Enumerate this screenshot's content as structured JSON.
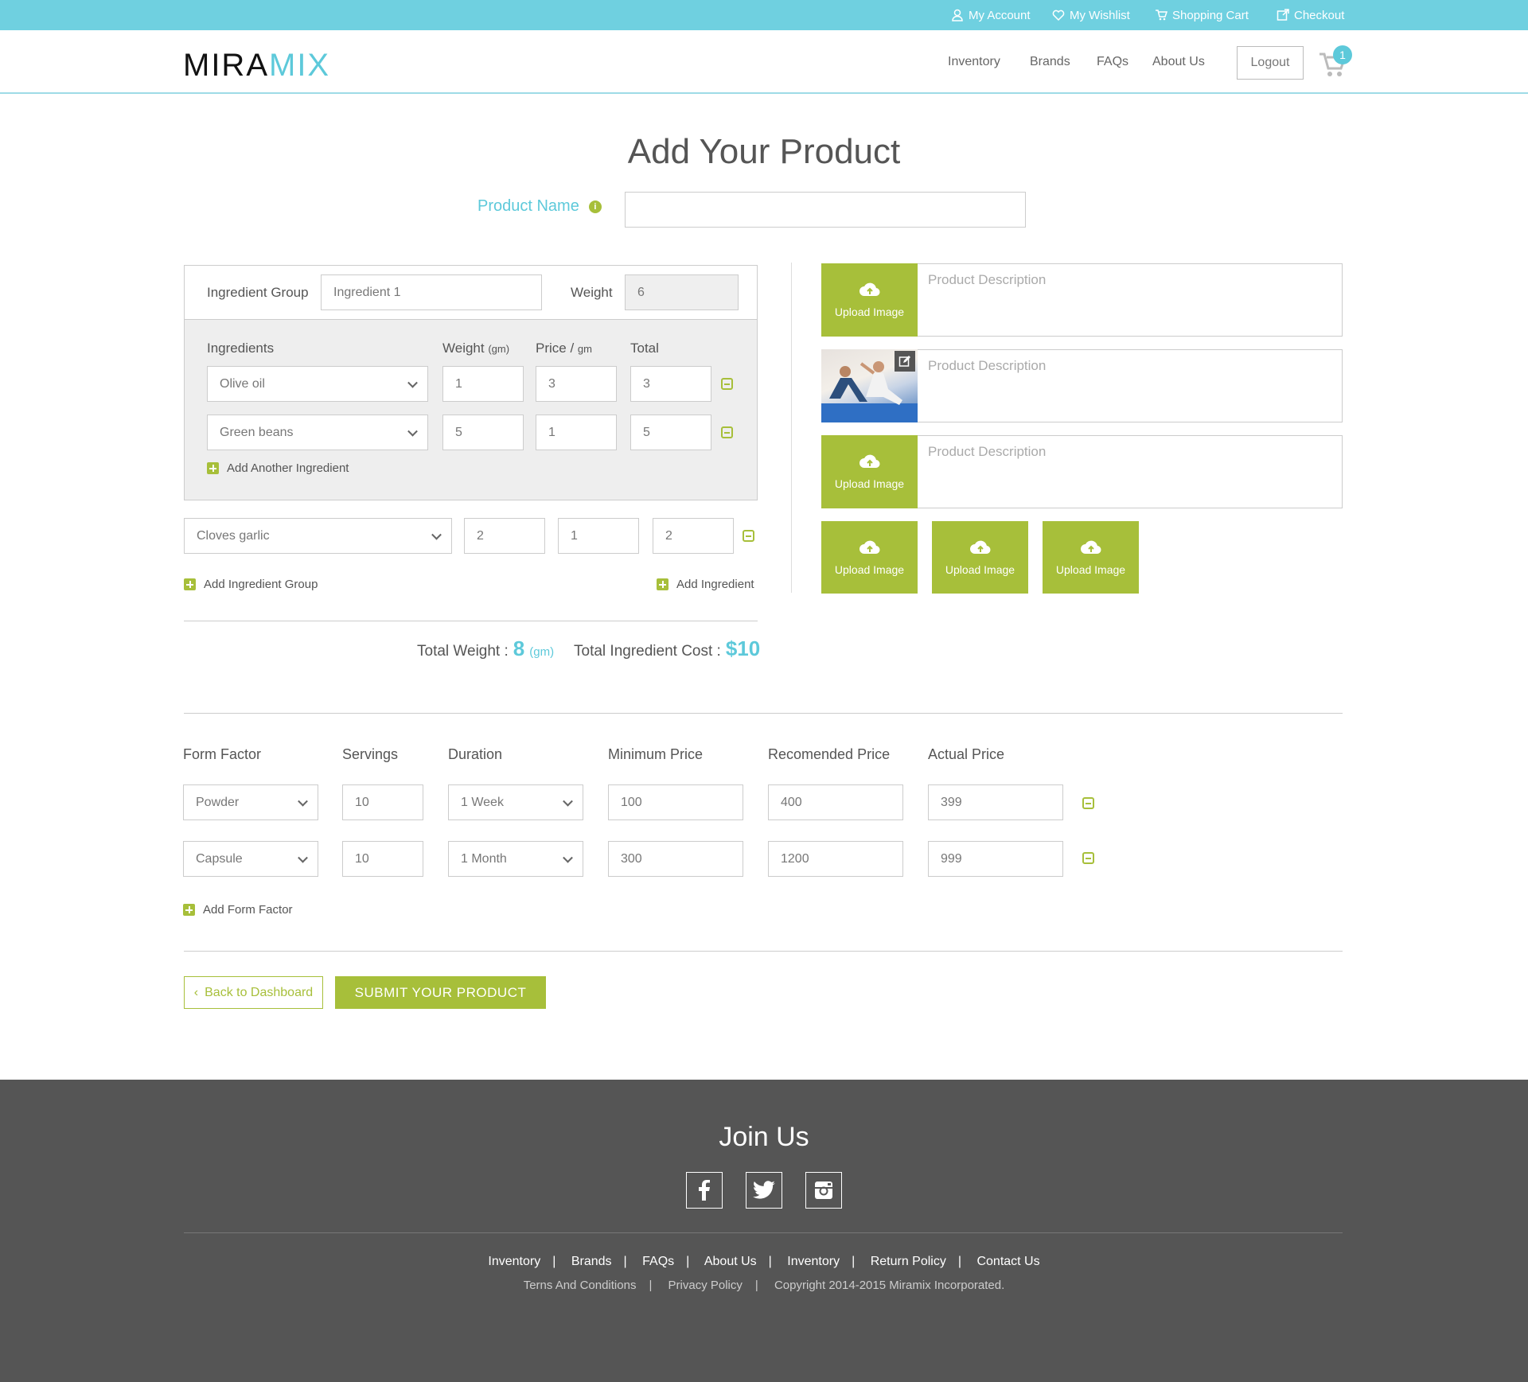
{
  "topbar": {
    "my_account": "My Account",
    "my_wishlist": "My Wishlist",
    "shopping_cart": "Shopping Cart",
    "checkout": "Checkout"
  },
  "header": {
    "logo_part1": "MIRA",
    "logo_part2": "MIX",
    "nav": [
      "Inventory",
      "Brands",
      "FAQs",
      "About Us"
    ],
    "logout": "Logout",
    "cart_count": "1"
  },
  "page": {
    "title": "Add Your Product",
    "product_name_label": "Product Name",
    "product_name_value": ""
  },
  "ingredient_group": {
    "group_label": "Ingredient Group",
    "group_value": "Ingredient 1",
    "weight_label": "Weight",
    "weight_value": "6",
    "col_ingredients": "Ingredients",
    "col_weight": "Weight",
    "col_weight_unit": "(gm)",
    "col_price": "Price /",
    "col_price_unit": "gm",
    "col_total": "Total",
    "rows": [
      {
        "name": "Olive oil",
        "weight": "1",
        "price": "3",
        "total": "3"
      },
      {
        "name": "Green beans",
        "weight": "5",
        "price": "1",
        "total": "5"
      }
    ],
    "add_another": "Add Another Ingredient"
  },
  "extra_ingredient": {
    "name": "Cloves garlic",
    "weight": "2",
    "price": "1",
    "total": "2"
  },
  "add_ingredient_group": "Add Ingredient Group",
  "add_ingredient": "Add Ingredient",
  "totals": {
    "weight_label": "Total Weight :",
    "weight_value": "8",
    "weight_unit": "(gm)",
    "cost_label": "Total Ingredient Cost :",
    "cost_value": "$10"
  },
  "descriptions": {
    "placeholder": "Product Description",
    "upload_label": "Upload Image"
  },
  "form_factor": {
    "headers": [
      "Form Factor",
      "Servings",
      "Duration",
      "Minimum Price",
      "Recomended Price",
      "Actual Price"
    ],
    "rows": [
      {
        "form": "Powder",
        "servings": "10",
        "duration": "1 Week",
        "min": "100",
        "rec": "400",
        "actual": "399"
      },
      {
        "form": "Capsule",
        "servings": "10",
        "duration": "1 Month",
        "min": "300",
        "rec": "1200",
        "actual": "999"
      }
    ],
    "add_label": "Add Form Factor"
  },
  "buttons": {
    "back": "Back to Dashboard",
    "submit": "SUBMIT YOUR PRODUCT"
  },
  "footer": {
    "join": "Join Us",
    "links": [
      "Inventory",
      "Brands",
      "FAQs",
      "About Us",
      "Inventory",
      "Return Policy",
      "Contact Us"
    ],
    "sub_links": [
      "Terns And Conditions",
      "Privacy Policy",
      "Copyright 2014-2015 Miramix Incorporated."
    ]
  },
  "colors": {
    "accent_blue": "#5dc9da",
    "topbar": "#6fd0e0",
    "accent_green": "#a7bf3a",
    "footer": "#555555"
  }
}
